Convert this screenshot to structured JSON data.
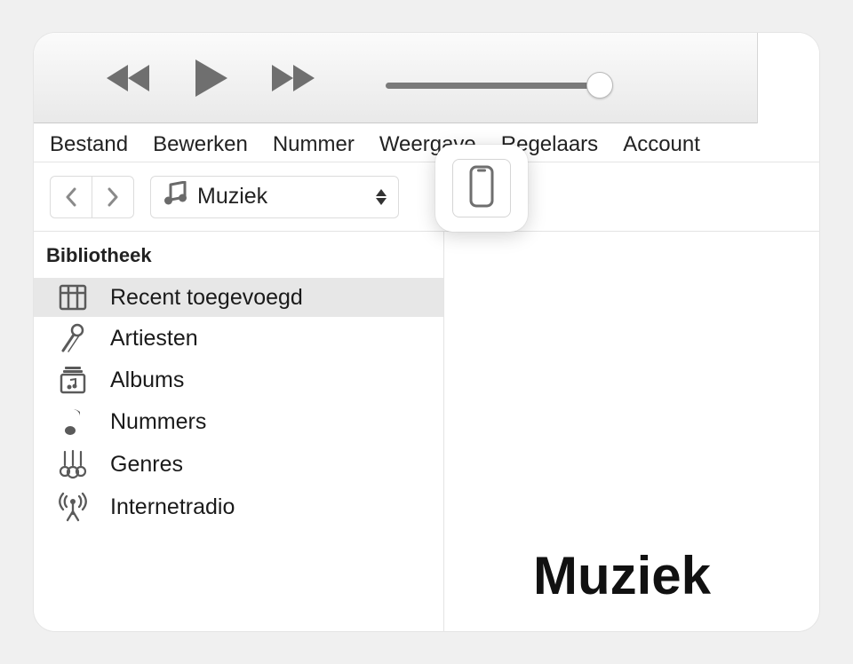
{
  "menubar": {
    "items": [
      "Bestand",
      "Bewerken",
      "Nummer",
      "Weergave",
      "Regelaars",
      "Account"
    ]
  },
  "toolbar": {
    "source_label": "Muziek",
    "source_icon": "music-icon",
    "device_icon": "phone-icon"
  },
  "sidebar": {
    "header": "Bibliotheek",
    "items": [
      {
        "icon": "grid-icon",
        "label": "Recent toegevoegd",
        "selected": true
      },
      {
        "icon": "mic-icon",
        "label": "Artiesten",
        "selected": false
      },
      {
        "icon": "album-icon",
        "label": "Albums",
        "selected": false
      },
      {
        "icon": "note-icon",
        "label": "Nummers",
        "selected": false
      },
      {
        "icon": "guitars-icon",
        "label": "Genres",
        "selected": false
      },
      {
        "icon": "antenna-icon",
        "label": "Internetradio",
        "selected": false
      }
    ]
  },
  "main": {
    "heading": "Muziek"
  }
}
